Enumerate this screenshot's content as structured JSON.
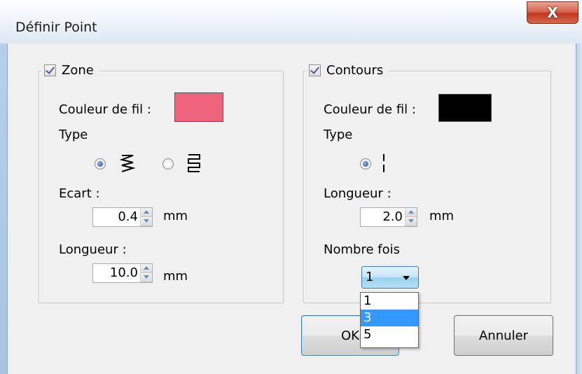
{
  "window": {
    "title": "Définir Point",
    "close_label": "X"
  },
  "zone": {
    "checkbox_label": "Zone",
    "checked": true,
    "color_label": "Couleur de fil :",
    "color": "#f0637d",
    "type_label": "Type",
    "type_options": [
      {
        "icon": "zigzag-fill-icon",
        "selected": true
      },
      {
        "icon": "parallel-lines-fill-icon",
        "selected": false
      }
    ],
    "ecart_label": "Ecart :",
    "ecart_value": "0.4",
    "ecart_unit": "mm",
    "longueur_label": "Longueur :",
    "longueur_value": "10.0",
    "longueur_unit": "mm"
  },
  "contours": {
    "checkbox_label": "Contours",
    "checked": true,
    "color_label": "Couleur de fil :",
    "color": "#000000",
    "type_label": "Type",
    "type_options": [
      {
        "icon": "dashed-line-icon",
        "selected": true
      }
    ],
    "longueur_label": "Longueur :",
    "longueur_value": "2.0",
    "longueur_unit": "mm",
    "nombre_label": "Nombre fois",
    "nombre_value": "1",
    "nombre_options": [
      "1",
      "3",
      "5"
    ],
    "nombre_highlighted": "3"
  },
  "buttons": {
    "ok": "OK",
    "cancel": "Annuler"
  },
  "colors": {
    "accent": "#3399ff",
    "title_gradient": "#dde8f4",
    "client_bg": "#f0f0f0"
  }
}
